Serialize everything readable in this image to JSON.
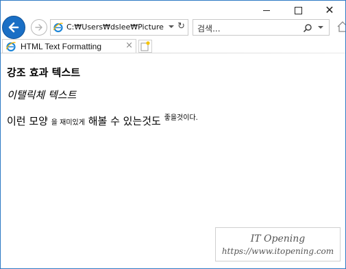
{
  "window": {
    "minimize_label": "",
    "maximize_label": "",
    "close_label": "✕"
  },
  "address": {
    "url": "C:₩Users₩dslee₩Pictures₩"
  },
  "search": {
    "placeholder": "검색..."
  },
  "tab": {
    "title": "HTML Text Formatting",
    "close_glyph": "×"
  },
  "page": {
    "strong_text": "강조 효과 텍스트",
    "italic_text": "이탤릭체 텍스트",
    "line_start": "이런 모양",
    "small_text": "을 재미있게",
    "line_mid": "해볼 수 있는것도",
    "sup_text": "좋을것이다."
  },
  "watermark": {
    "title": "IT Opening",
    "url": "https://www.itopening.com"
  },
  "colors": {
    "accent": "#1a6fc5",
    "window_border": "#2b78c4"
  }
}
